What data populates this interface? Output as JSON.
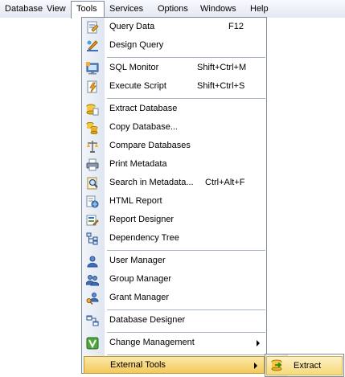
{
  "menubar": {
    "items": [
      {
        "label": "Database"
      },
      {
        "label": "View"
      },
      {
        "label": "Tools",
        "active": true
      },
      {
        "label": "Services"
      },
      {
        "label": "Options"
      },
      {
        "label": "Windows"
      },
      {
        "label": "Help"
      }
    ]
  },
  "tools_menu": {
    "items": [
      {
        "label": "Query Data",
        "shortcut": "F12",
        "icon": "query-data-icon"
      },
      {
        "label": "Design Query",
        "shortcut": "",
        "icon": "design-query-icon"
      },
      {
        "label": "SQL Monitor",
        "shortcut": "Shift+Ctrl+M",
        "icon": "sql-monitor-icon"
      },
      {
        "label": "Execute Script",
        "shortcut": "Shift+Ctrl+S",
        "icon": "execute-script-icon"
      },
      {
        "label": "Extract Database",
        "shortcut": "",
        "icon": "extract-database-icon"
      },
      {
        "label": "Copy Database...",
        "shortcut": "",
        "icon": "copy-database-icon"
      },
      {
        "label": "Compare Databases",
        "shortcut": "",
        "icon": "compare-databases-icon"
      },
      {
        "label": "Print Metadata",
        "shortcut": "",
        "icon": "printer-icon"
      },
      {
        "label": "Search in Metadata...",
        "shortcut": "Ctrl+Alt+F",
        "icon": "search-metadata-icon"
      },
      {
        "label": "HTML Report",
        "shortcut": "",
        "icon": "html-report-icon"
      },
      {
        "label": "Report Designer",
        "shortcut": "",
        "icon": "report-designer-icon"
      },
      {
        "label": "Dependency Tree",
        "shortcut": "",
        "icon": "dependency-tree-icon"
      },
      {
        "label": "User Manager",
        "shortcut": "",
        "icon": "user-icon"
      },
      {
        "label": "Group Manager",
        "shortcut": "",
        "icon": "group-icon"
      },
      {
        "label": "Grant Manager",
        "shortcut": "",
        "icon": "grant-key-icon"
      },
      {
        "label": "Database Designer",
        "shortcut": "",
        "icon": "database-designer-icon"
      },
      {
        "label": "Change Management",
        "shortcut": "",
        "icon": "change-management-icon",
        "submenu": true
      },
      {
        "label": "External Tools",
        "shortcut": "",
        "icon": "",
        "submenu": true,
        "highlighted": true
      }
    ]
  },
  "external_tools_submenu": {
    "items": [
      {
        "label": "Extract",
        "icon": "extract-icon"
      }
    ]
  }
}
